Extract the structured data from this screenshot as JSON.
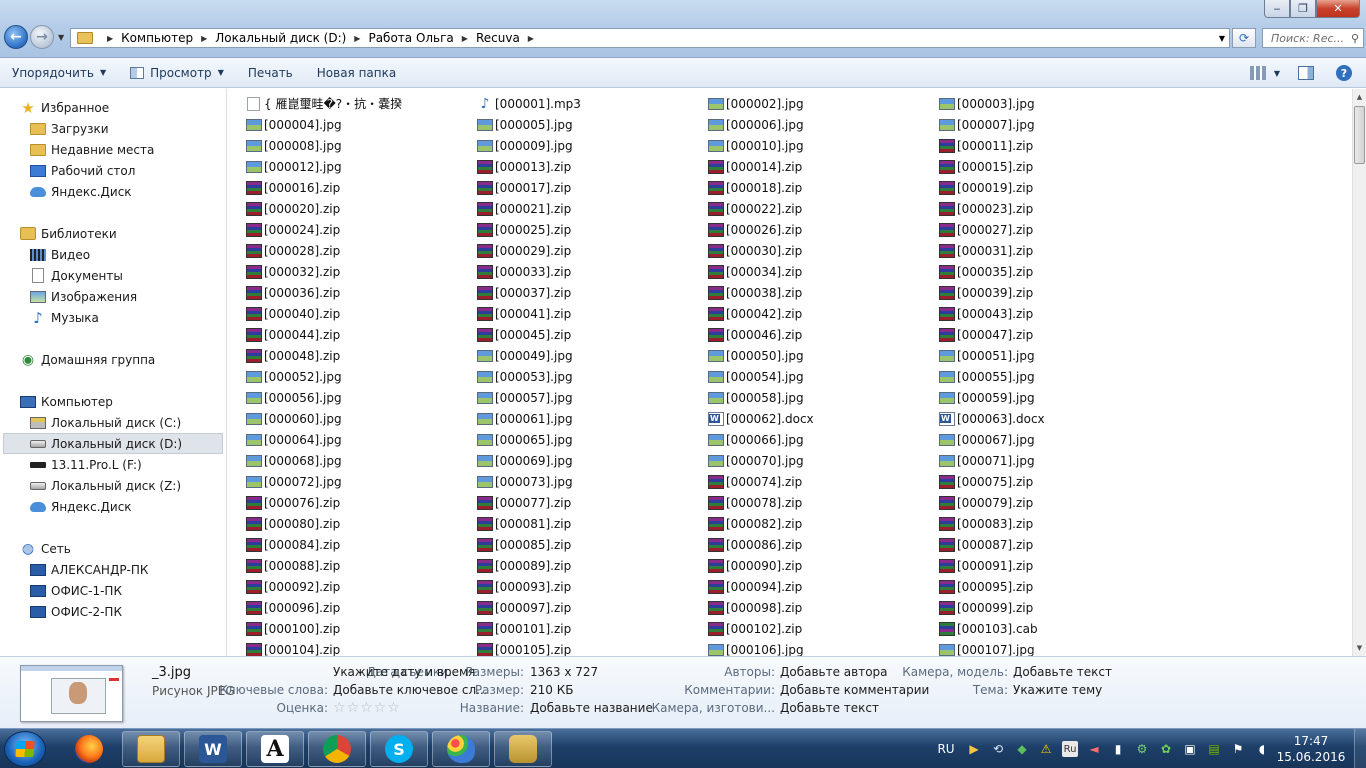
{
  "window": {
    "minimize_label": "‒",
    "maximize_label": "❐",
    "close_label": "✕"
  },
  "address": {
    "crumbs": [
      "Компьютер",
      "Локальный диск (D:)",
      "Работа Ольга",
      "Recuva"
    ],
    "search_placeholder": "Поиск: Rec..."
  },
  "toolbar": {
    "organize": "Упорядочить",
    "view": "Просмотр",
    "print": "Печать",
    "new_folder": "Новая папка"
  },
  "navpane": {
    "favorites": "Избранное",
    "downloads": "Загрузки",
    "recent": "Недавние места",
    "desktop": "Рабочий стол",
    "yadisk1": "Яндекс.Диск",
    "libraries": "Библиотеки",
    "video": "Видео",
    "documents": "Документы",
    "images": "Изображения",
    "music": "Музыка",
    "homegroup": "Домашняя группа",
    "computer": "Компьютер",
    "drive_c": "Локальный диск (C:)",
    "drive_d": "Локальный диск (D:)",
    "drive_f": "13.11.Pro.L (F:)",
    "drive_z": "Локальный диск (Z:)",
    "yadisk2": "Яндекс.Диск",
    "network": "Сеть",
    "pc1": "АЛЕКСАНДР-ПК",
    "pc2": "ОФИС-1-ПК",
    "pc3": "ОФИС-2-ПК"
  },
  "files": [
    {
      "name": "{ 雁崑璽畦�?・抗・嚢揆",
      "type": "blank"
    },
    {
      "name": "[000001].mp3",
      "type": "mp3"
    },
    {
      "name": "[000002].jpg",
      "type": "jpg"
    },
    {
      "name": "[000003].jpg",
      "type": "jpg"
    },
    {
      "name": "[000004].jpg",
      "type": "jpg"
    },
    {
      "name": "[000005].jpg",
      "type": "jpg"
    },
    {
      "name": "[000006].jpg",
      "type": "jpg"
    },
    {
      "name": "[000007].jpg",
      "type": "jpg"
    },
    {
      "name": "[000008].jpg",
      "type": "jpg"
    },
    {
      "name": "[000009].jpg",
      "type": "jpg"
    },
    {
      "name": "[000010].jpg",
      "type": "jpg"
    },
    {
      "name": "[000011].zip",
      "type": "zip"
    },
    {
      "name": "[000012].jpg",
      "type": "jpg"
    },
    {
      "name": "[000013].zip",
      "type": "zip"
    },
    {
      "name": "[000014].zip",
      "type": "zip"
    },
    {
      "name": "[000015].zip",
      "type": "zip"
    },
    {
      "name": "[000016].zip",
      "type": "zip"
    },
    {
      "name": "[000017].zip",
      "type": "zip"
    },
    {
      "name": "[000018].zip",
      "type": "zip"
    },
    {
      "name": "[000019].zip",
      "type": "zip"
    },
    {
      "name": "[000020].zip",
      "type": "zip"
    },
    {
      "name": "[000021].zip",
      "type": "zip"
    },
    {
      "name": "[000022].zip",
      "type": "zip"
    },
    {
      "name": "[000023].zip",
      "type": "zip"
    },
    {
      "name": "[000024].zip",
      "type": "zip"
    },
    {
      "name": "[000025].zip",
      "type": "zip"
    },
    {
      "name": "[000026].zip",
      "type": "zip"
    },
    {
      "name": "[000027].zip",
      "type": "zip"
    },
    {
      "name": "[000028].zip",
      "type": "zip"
    },
    {
      "name": "[000029].zip",
      "type": "zip"
    },
    {
      "name": "[000030].zip",
      "type": "zip"
    },
    {
      "name": "[000031].zip",
      "type": "zip"
    },
    {
      "name": "[000032].zip",
      "type": "zip"
    },
    {
      "name": "[000033].zip",
      "type": "zip"
    },
    {
      "name": "[000034].zip",
      "type": "zip"
    },
    {
      "name": "[000035].zip",
      "type": "zip"
    },
    {
      "name": "[000036].zip",
      "type": "zip"
    },
    {
      "name": "[000037].zip",
      "type": "zip"
    },
    {
      "name": "[000038].zip",
      "type": "zip"
    },
    {
      "name": "[000039].zip",
      "type": "zip"
    },
    {
      "name": "[000040].zip",
      "type": "zip"
    },
    {
      "name": "[000041].zip",
      "type": "zip"
    },
    {
      "name": "[000042].zip",
      "type": "zip"
    },
    {
      "name": "[000043].zip",
      "type": "zip"
    },
    {
      "name": "[000044].zip",
      "type": "zip"
    },
    {
      "name": "[000045].zip",
      "type": "zip"
    },
    {
      "name": "[000046].zip",
      "type": "zip"
    },
    {
      "name": "[000047].zip",
      "type": "zip"
    },
    {
      "name": "[000048].zip",
      "type": "zip"
    },
    {
      "name": "[000049].jpg",
      "type": "jpg"
    },
    {
      "name": "[000050].jpg",
      "type": "jpg"
    },
    {
      "name": "[000051].jpg",
      "type": "jpg"
    },
    {
      "name": "[000052].jpg",
      "type": "jpg"
    },
    {
      "name": "[000053].jpg",
      "type": "jpg"
    },
    {
      "name": "[000054].jpg",
      "type": "jpg"
    },
    {
      "name": "[000055].jpg",
      "type": "jpg"
    },
    {
      "name": "[000056].jpg",
      "type": "jpg"
    },
    {
      "name": "[000057].jpg",
      "type": "jpg"
    },
    {
      "name": "[000058].jpg",
      "type": "jpg"
    },
    {
      "name": "[000059].jpg",
      "type": "jpg"
    },
    {
      "name": "[000060].jpg",
      "type": "jpg"
    },
    {
      "name": "[000061].jpg",
      "type": "jpg"
    },
    {
      "name": "[000062].docx",
      "type": "docx"
    },
    {
      "name": "[000063].docx",
      "type": "docx"
    },
    {
      "name": "[000064].jpg",
      "type": "jpg"
    },
    {
      "name": "[000065].jpg",
      "type": "jpg"
    },
    {
      "name": "[000066].jpg",
      "type": "jpg"
    },
    {
      "name": "[000067].jpg",
      "type": "jpg"
    },
    {
      "name": "[000068].jpg",
      "type": "jpg"
    },
    {
      "name": "[000069].jpg",
      "type": "jpg"
    },
    {
      "name": "[000070].jpg",
      "type": "jpg"
    },
    {
      "name": "[000071].jpg",
      "type": "jpg"
    },
    {
      "name": "[000072].jpg",
      "type": "jpg"
    },
    {
      "name": "[000073].jpg",
      "type": "jpg"
    },
    {
      "name": "[000074].zip",
      "type": "zip"
    },
    {
      "name": "[000075].zip",
      "type": "zip"
    },
    {
      "name": "[000076].zip",
      "type": "zip"
    },
    {
      "name": "[000077].zip",
      "type": "zip"
    },
    {
      "name": "[000078].zip",
      "type": "zip"
    },
    {
      "name": "[000079].zip",
      "type": "zip"
    },
    {
      "name": "[000080].zip",
      "type": "zip"
    },
    {
      "name": "[000081].zip",
      "type": "zip"
    },
    {
      "name": "[000082].zip",
      "type": "zip"
    },
    {
      "name": "[000083].zip",
      "type": "zip"
    },
    {
      "name": "[000084].zip",
      "type": "zip"
    },
    {
      "name": "[000085].zip",
      "type": "zip"
    },
    {
      "name": "[000086].zip",
      "type": "zip"
    },
    {
      "name": "[000087].zip",
      "type": "zip"
    },
    {
      "name": "[000088].zip",
      "type": "zip"
    },
    {
      "name": "[000089].zip",
      "type": "zip"
    },
    {
      "name": "[000090].zip",
      "type": "zip"
    },
    {
      "name": "[000091].zip",
      "type": "zip"
    },
    {
      "name": "[000092].zip",
      "type": "zip"
    },
    {
      "name": "[000093].zip",
      "type": "zip"
    },
    {
      "name": "[000094].zip",
      "type": "zip"
    },
    {
      "name": "[000095].zip",
      "type": "zip"
    },
    {
      "name": "[000096].zip",
      "type": "zip"
    },
    {
      "name": "[000097].zip",
      "type": "zip"
    },
    {
      "name": "[000098].zip",
      "type": "zip"
    },
    {
      "name": "[000099].zip",
      "type": "zip"
    },
    {
      "name": "[000100].zip",
      "type": "zip"
    },
    {
      "name": "[000101].zip",
      "type": "zip"
    },
    {
      "name": "[000102].zip",
      "type": "zip"
    },
    {
      "name": "[000103].cab",
      "type": "cab"
    },
    {
      "name": "[000104].zip",
      "type": "zip"
    },
    {
      "name": "[000105].zip",
      "type": "zip"
    },
    {
      "name": "[000106].jpg",
      "type": "jpg"
    },
    {
      "name": "[000107].jpg",
      "type": "jpg"
    }
  ],
  "details": {
    "file_name": "_3.jpg",
    "file_type": "Рисунок JPEG",
    "date_taken_label": "Дата съемки:",
    "date_taken_value": "Укажите дату и время",
    "keywords_label": "Ключевые слова:",
    "keywords_value": "Добавьте ключевое сл...",
    "rating_label": "Оценка:",
    "rating_stars": "☆☆☆☆☆",
    "dimensions_label": "Размеры:",
    "dimensions_value": "1363 x 727",
    "size_label": "Размер:",
    "size_value": "210 КБ",
    "title_label": "Название:",
    "title_value": "Добавьте название",
    "authors_label": "Авторы:",
    "authors_value": "Добавьте автора",
    "comments_label": "Комментарии:",
    "comments_value": "Добавьте комментарии",
    "maker_label": "Камера, изготови...",
    "maker_value": "Добавьте текст",
    "model_label": "Камера, модель:",
    "model_value": "Добавьте текст",
    "subject_label": "Тема:",
    "subject_value": "Укажите тему"
  },
  "taskbar": {
    "lang": "RU",
    "ime": "Ru",
    "time": "17:47",
    "date": "15.06.2016",
    "word_glyph": "W",
    "font_glyph": "A",
    "skype_glyph": "S"
  }
}
